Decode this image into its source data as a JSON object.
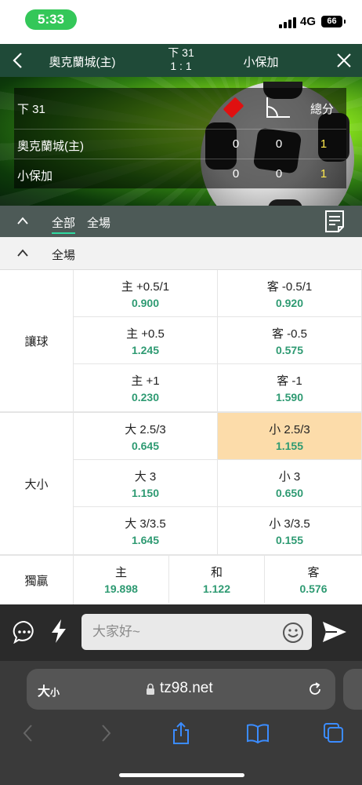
{
  "status_bar": {
    "time": "5:33",
    "network": "4G",
    "battery": "66"
  },
  "header": {
    "home_team": "奧克蘭城(主)",
    "period": "下 31",
    "score": "1 : 1",
    "away_team": "小保加"
  },
  "scoreboard": {
    "period": "下 31",
    "total_label": "總分",
    "teams": [
      {
        "name": "奧克蘭城(主)",
        "red_cards": "0",
        "corners": "0",
        "total": "1"
      },
      {
        "name": "小保加",
        "red_cards": "0",
        "corners": "0",
        "total": "1"
      }
    ]
  },
  "tabs": [
    "全部",
    "全場"
  ],
  "section": {
    "title": "全場"
  },
  "markets": {
    "handicap": {
      "label": "讓球",
      "rows": [
        [
          {
            "label": "主 +0.5/1",
            "odds": "0.900"
          },
          {
            "label": "客 -0.5/1",
            "odds": "0.920"
          }
        ],
        [
          {
            "label": "主 +0.5",
            "odds": "1.245"
          },
          {
            "label": "客 -0.5",
            "odds": "0.575"
          }
        ],
        [
          {
            "label": "主 +1",
            "odds": "0.230"
          },
          {
            "label": "客 -1",
            "odds": "1.590"
          }
        ]
      ]
    },
    "over_under": {
      "label": "大小",
      "rows": [
        [
          {
            "label": "大 2.5/3",
            "odds": "0.645"
          },
          {
            "label": "小 2.5/3",
            "odds": "1.155"
          }
        ],
        [
          {
            "label": "大 3",
            "odds": "1.150"
          },
          {
            "label": "小 3",
            "odds": "0.650"
          }
        ],
        [
          {
            "label": "大 3/3.5",
            "odds": "1.645"
          },
          {
            "label": "小 3/3.5",
            "odds": "0.155"
          }
        ]
      ]
    },
    "moneyline": {
      "label": "獨贏",
      "cells": [
        {
          "label": "主",
          "odds": "19.898"
        },
        {
          "label": "和",
          "odds": "1.122"
        },
        {
          "label": "客",
          "odds": "0.576"
        }
      ]
    }
  },
  "chat": {
    "placeholder": "大家好~"
  },
  "browser": {
    "text_size_label": "大",
    "text_size_small": "小",
    "url": "tz98.net"
  },
  "colors": {
    "header_bg": "#1f4a38",
    "odds_green": "#2e9a72",
    "selected_cell": "#fcdcaa",
    "tab_underline": "#2fd9a0"
  }
}
